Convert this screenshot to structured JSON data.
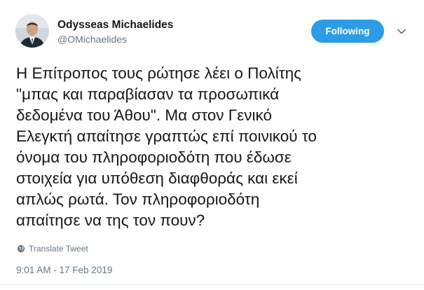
{
  "user": {
    "name": "Odysseas Michaelides",
    "handle": "@OMichaelides"
  },
  "follow_button": {
    "label": "Following"
  },
  "tweet": {
    "text": "Η Επίτροπος τους ρώτησε λέει ο Πολίτης\n\"μπας και παραβίασαν τα προσωπικά\nδεδομένα του Άθου\". Μα στον Γενικό\nΕλεγκτή απαίτησε γραπτώς επί ποινικού το\nόνομα του πληροφοριοδότη που έδωσε\nστοιχεία για υπόθεση διαφθοράς και εκεί\nαπλώς ρωτά. Τον πληροφοριοδότη\nαπαίτησε να της τον πουν?",
    "translate_label": "Translate Tweet",
    "timestamp": "9:01 AM - 17 Feb 2019"
  },
  "icons": {
    "menu": "chevron-down-icon",
    "translate": "globe-icon"
  },
  "colors": {
    "accent": "#2b9ce5",
    "text": "#14171a",
    "muted": "#657786"
  }
}
